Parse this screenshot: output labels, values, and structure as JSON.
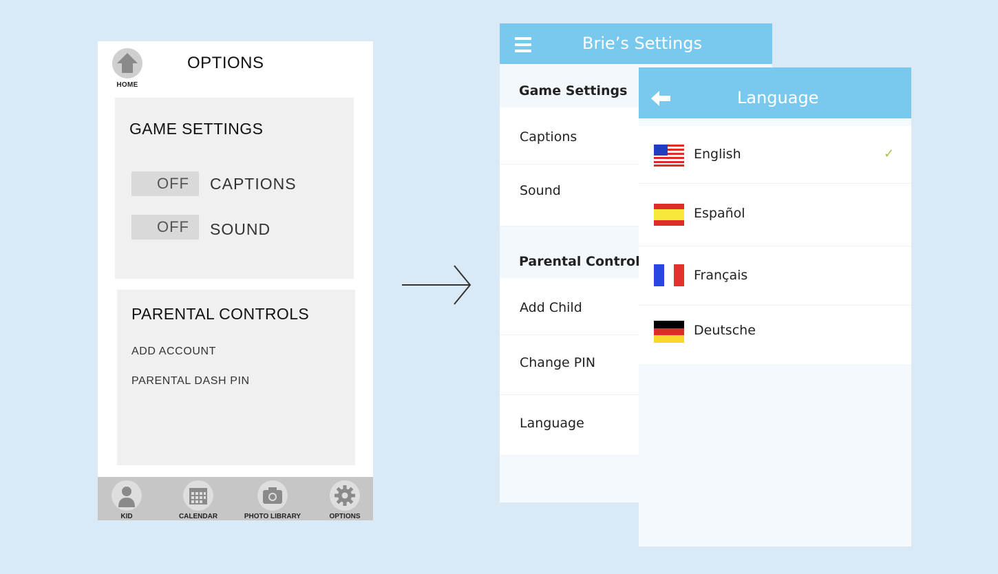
{
  "colors": {
    "accent": "#79c9ef",
    "check": "#9bc53d",
    "wireframe_bg": "#f0f0f0"
  },
  "wireframe": {
    "home_label": "HOME",
    "title": "OPTIONS",
    "game_settings": {
      "heading": "GAME SETTINGS",
      "toggles": [
        {
          "state": "OFF",
          "label": "CAPTIONS"
        },
        {
          "state": "OFF",
          "label": "SOUND"
        }
      ]
    },
    "parental_controls": {
      "heading": "PARENTAL CONTROLS",
      "links": [
        "ADD ACCOUNT",
        "PARENTAL DASH PIN"
      ]
    },
    "nav": [
      {
        "label": "KID",
        "icon": "person-icon"
      },
      {
        "label": "CALENDAR",
        "icon": "calendar-icon"
      },
      {
        "label": "PHOTO LIBRARY",
        "icon": "camera-icon"
      },
      {
        "label": "OPTIONS",
        "icon": "gear-icon"
      }
    ]
  },
  "settings": {
    "title": "Brie’s Settings",
    "menu_icon": "hamburger-icon",
    "sections": [
      {
        "heading": "Game Settings",
        "items": [
          "Captions",
          "Sound"
        ]
      },
      {
        "heading": "Parental Controls",
        "items": [
          "Add Child",
          "Change PIN",
          "Language"
        ]
      }
    ]
  },
  "language": {
    "title": "Language",
    "back_icon": "back-arrow-icon",
    "options": [
      {
        "name": "English",
        "flag": "us-flag-icon",
        "selected": true,
        "check": "✓"
      },
      {
        "name": "Español",
        "flag": "spain-flag-icon",
        "selected": false
      },
      {
        "name": "Français",
        "flag": "france-flag-icon",
        "selected": false
      },
      {
        "name": "Deutsche",
        "flag": "germany-flag-icon",
        "selected": false
      }
    ]
  }
}
